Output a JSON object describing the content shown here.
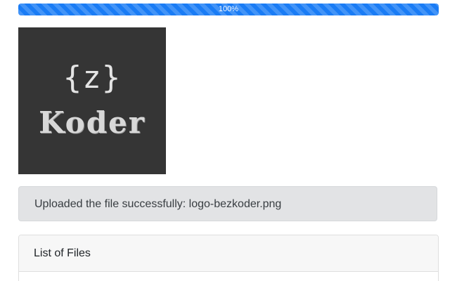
{
  "upload": {
    "progress_percent": 100,
    "progress_label": "100%"
  },
  "preview": {
    "logo_braces": "{z}",
    "logo_word": "Koder"
  },
  "alert": {
    "message": "Uploaded the file successfully: logo-bezkoder.png"
  },
  "files_card": {
    "header": "List of Files"
  }
}
